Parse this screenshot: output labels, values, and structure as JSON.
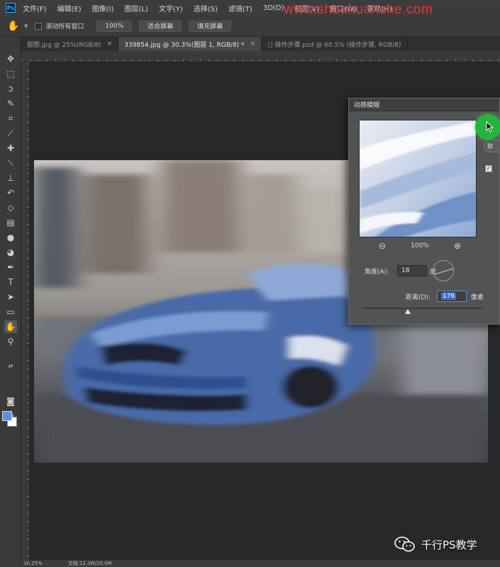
{
  "app": {
    "logo_text": "Ps",
    "menu": [
      "文件(F)",
      "编辑(E)",
      "图像(I)",
      "图层(L)",
      "文字(Y)",
      "选择(S)",
      "滤镜(T)",
      "3D(D)",
      "视图(V)",
      "窗口(W)",
      "帮助(H)"
    ],
    "watermark": "www.shouhuanshe.com"
  },
  "options_bar": {
    "scroll_all_label": "滚动所有窗口",
    "zoom_value": "100%",
    "fit_screen": "适合屏幕",
    "fill_screen": "填充屏幕"
  },
  "tabs": [
    {
      "label": "部图.jpg @ 25%(RGB/8)",
      "close": "×",
      "active": false
    },
    {
      "label": "339854.jpg @ 30.3%(图层 1, RGB/8) *",
      "close": "×",
      "active": true
    },
    {
      "label": "◻ 操作步骤.psd @ 60.5% (操作步骤, RGB/8)",
      "close": "",
      "active": false
    }
  ],
  "motion_blur": {
    "title": "动感模糊",
    "zoom_label": "100%",
    "angle_label": "角度(A):",
    "angle_value": "18",
    "angle_unit": "度",
    "distance_label": "距离(D):",
    "distance_value": "176",
    "distance_unit": "像素",
    "side_button": "取",
    "distance_slider_fraction": 0.38
  },
  "status": {
    "zoom": "30.25%",
    "doc": "文档:12.3M/20.0M"
  },
  "wechat_badge": {
    "label": "千行PS教学"
  },
  "colors": {
    "foreground": "#5d8fe0",
    "background": "#ffffff",
    "ok_button": "#25b53c",
    "watermark": "#e0393e"
  },
  "icons": [
    "move-icon",
    "marquee-icon",
    "lasso-icon",
    "quick-select-icon",
    "crop-icon",
    "eyedropper-icon",
    "healing-icon",
    "brush-icon",
    "stamp-icon",
    "history-brush-icon",
    "eraser-icon",
    "gradient-icon",
    "blur-icon",
    "dodge-icon",
    "pen-icon",
    "type-icon",
    "path-select-icon",
    "rectangle-icon",
    "hand-icon",
    "zoom-icon",
    "quick-mask-icon",
    "screen-mode-icon"
  ]
}
